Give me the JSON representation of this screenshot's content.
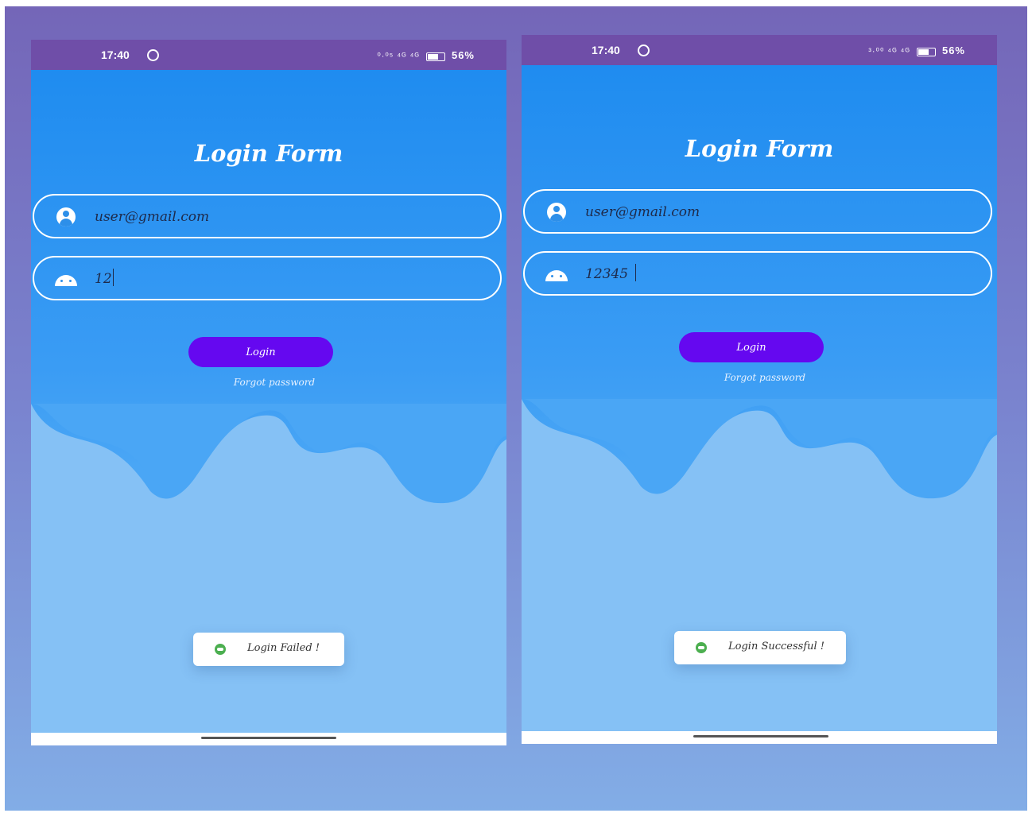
{
  "phones": [
    {
      "status_time": "17:40",
      "status_icons": "⁰·⁰⁵ ⁴ᴳ ⁴ᴳ",
      "battery": "56%",
      "title": "Login Form",
      "email_value": "user@gmail.com",
      "password_value": "12",
      "login_label": "Login",
      "forgot_label": "Forgot password",
      "toast_text": "Login Failed !"
    },
    {
      "status_time": "17:40",
      "status_icons": "³·⁰⁰ ⁴ᴳ ⁴ᴳ",
      "battery": "56%",
      "title": "Login Form",
      "email_value": "user@gmail.com",
      "password_value": "12345",
      "login_label": "Login",
      "forgot_label": "Forgot password",
      "toast_text": "Login Successful !"
    }
  ],
  "colors": {
    "status_bar": "#6f4ea8",
    "button": "#6508f0",
    "toast_icon": "#4caf50"
  }
}
